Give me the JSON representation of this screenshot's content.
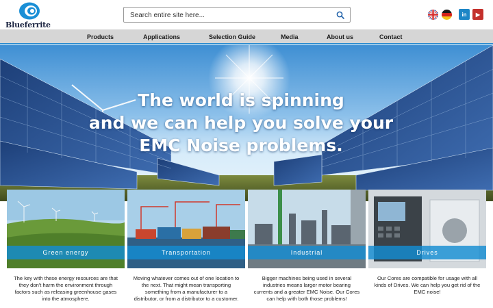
{
  "brand": {
    "name": "Blueferrite",
    "color": "#1a8fd6"
  },
  "search": {
    "placeholder": "Search entire site here..."
  },
  "header": {
    "flags": [
      "uk-flag",
      "germany-flag"
    ],
    "social": [
      {
        "icon": "linkedin-icon",
        "label": "in",
        "color": "#1d86c6"
      },
      {
        "icon": "youtube-icon",
        "label": "▶",
        "color": "#c4302b"
      }
    ]
  },
  "nav": {
    "items": [
      {
        "label": "Products"
      },
      {
        "label": "Applications"
      },
      {
        "label": "Selection Guide"
      },
      {
        "label": "Media"
      },
      {
        "label": "About us"
      },
      {
        "label": "Contact"
      }
    ],
    "accent": "#2a8bd0"
  },
  "hero": {
    "line1": "The world is spinning",
    "line2": "and we can help you solve your",
    "line3": "EMC Noise problems."
  },
  "cards": [
    {
      "title": "Green energy",
      "text": "The key with these energy resources are that they don't harm the environment through factors such as releasing greenhouse gases into the atmosphere."
    },
    {
      "title": "Transportation",
      "text": "Moving whatever comes out of one location to the next. That might mean transporting something from a manufacturer to a distributor, or from a distributor to a customer."
    },
    {
      "title": "Industrial",
      "text": "Bigger machines being used in several industries means larger motor bearing currents and a greater EMC Noise. Our Cores can help with both those problems!"
    },
    {
      "title": "Drives",
      "text": "Our Cores are compatible for usage with all kinds of Drives. We can help you get rid of the EMC noise!"
    }
  ]
}
